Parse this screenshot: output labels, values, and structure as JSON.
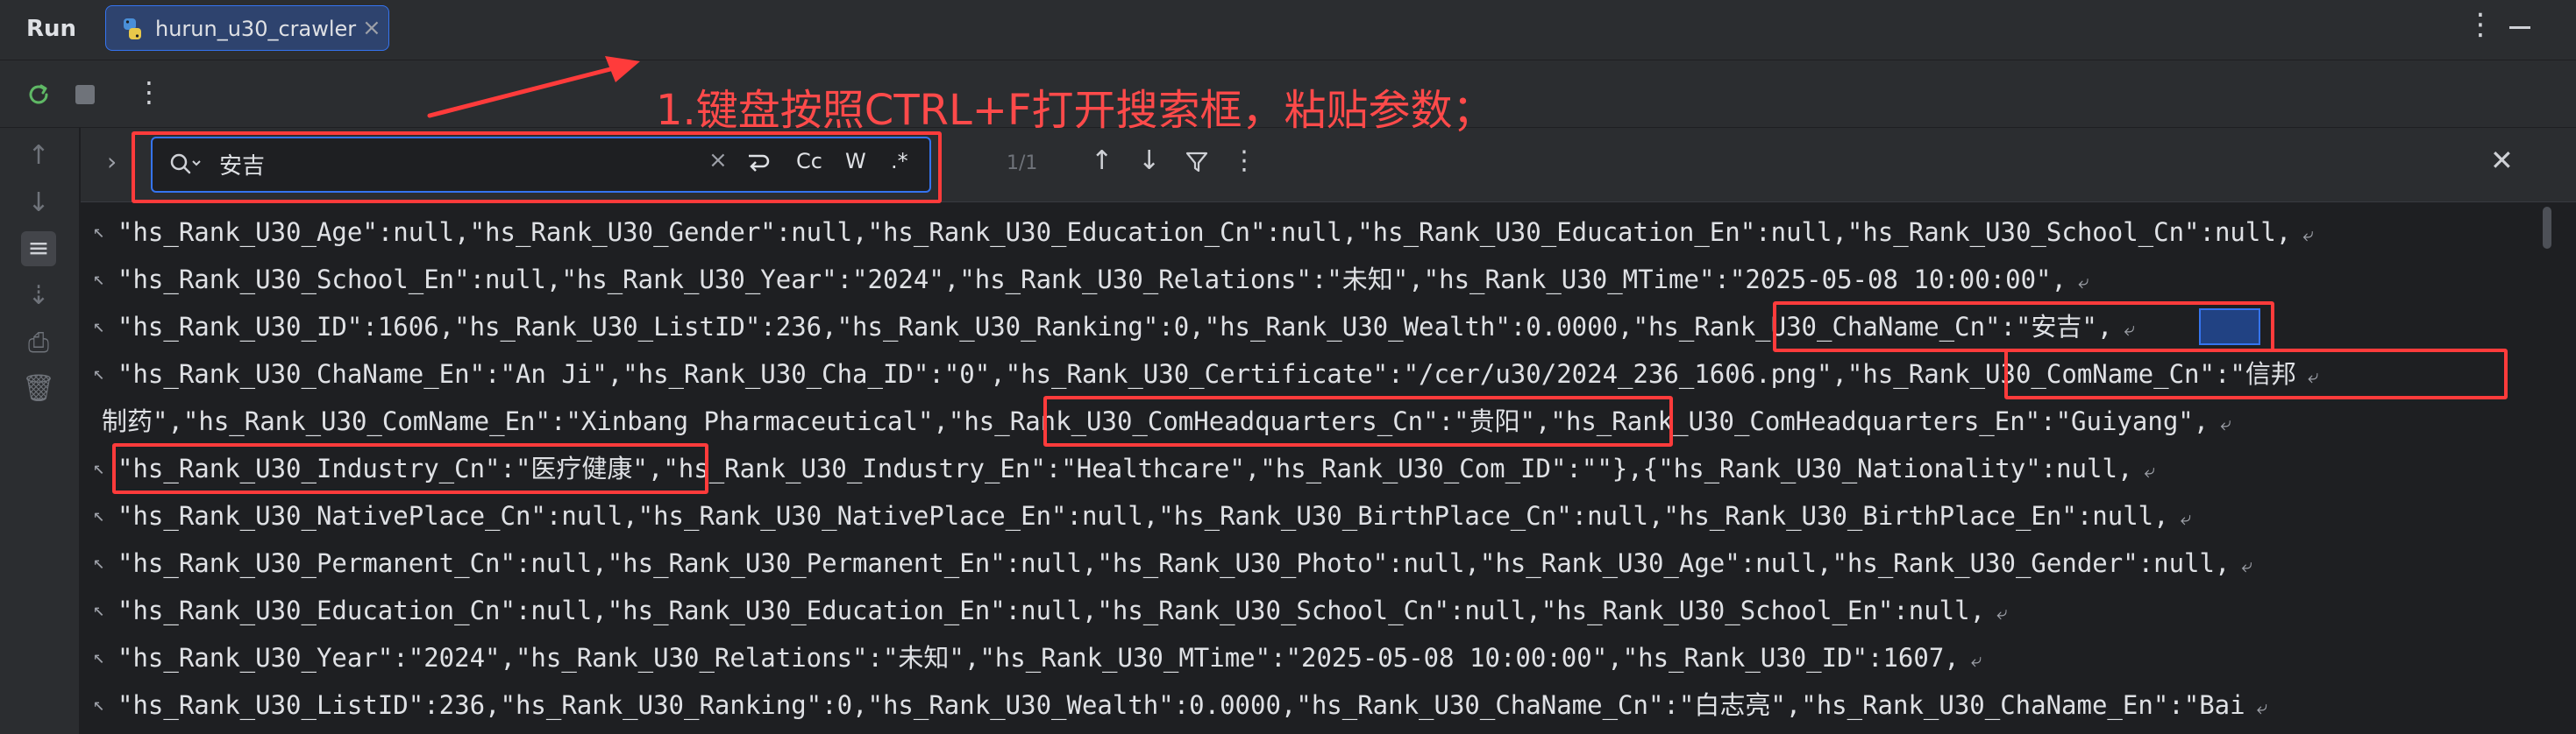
{
  "header": {
    "title": "Run",
    "tab_label": "hurun_u30_crawler"
  },
  "search": {
    "query": "安吉",
    "options": {
      "match_case": "Cc",
      "words": "W",
      "regex": ".*"
    },
    "match_count": "1/1"
  },
  "annotation": {
    "text": "1.键盘按照CTRL+F打开搜索框，粘贴参数；"
  },
  "console_lines": [
    "\"hs_Rank_U30_Age\":null,\"hs_Rank_U30_Gender\":null,\"hs_Rank_U30_Education_Cn\":null,\"hs_Rank_U30_Education_En\":null,\"hs_Rank_U30_School_Cn\":null,",
    "\"hs_Rank_U30_School_En\":null,\"hs_Rank_U30_Year\":\"2024\",\"hs_Rank_U30_Relations\":\"未知\",\"hs_Rank_U30_MTime\":\"2025-05-08 10:00:00\",",
    "\"hs_Rank_U30_ID\":1606,\"hs_Rank_U30_ListID\":236,\"hs_Rank_U30_Ranking\":0,\"hs_Rank_U30_Wealth\":0.0000,\"hs_Rank_U30_ChaName_Cn\":\"安吉\",",
    "\"hs_Rank_U30_ChaName_En\":\"An Ji\",\"hs_Rank_U30_Cha_ID\":\"0\",\"hs_Rank_U30_Certificate\":\"/cer/u30/2024_236_1606.png\",\"hs_Rank_U30_ComName_Cn\":\"信邦",
    "制药\",\"hs_Rank_U30_ComName_En\":\"Xinbang Pharmaceutical\",\"hs_Rank_U30_ComHeadquarters_Cn\":\"贵阳\",\"hs_Rank_U30_ComHeadquarters_En\":\"Guiyang\",",
    "\"hs_Rank_U30_Industry_Cn\":\"医疗健康\",\"hs_Rank_U30_Industry_En\":\"Healthcare\",\"hs_Rank_U30_Com_ID\":\"\"},{\"hs_Rank_U30_Nationality\":null,",
    "\"hs_Rank_U30_NativePlace_Cn\":null,\"hs_Rank_U30_NativePlace_En\":null,\"hs_Rank_U30_BirthPlace_Cn\":null,\"hs_Rank_U30_BirthPlace_En\":null,",
    "\"hs_Rank_U30_Permanent_Cn\":null,\"hs_Rank_U30_Permanent_En\":null,\"hs_Rank_U30_Photo\":null,\"hs_Rank_U30_Age\":null,\"hs_Rank_U30_Gender\":null,",
    "\"hs_Rank_U30_Education_Cn\":null,\"hs_Rank_U30_Education_En\":null,\"hs_Rank_U30_School_Cn\":null,\"hs_Rank_U30_School_En\":null,",
    "\"hs_Rank_U30_Year\":\"2024\",\"hs_Rank_U30_Relations\":\"未知\",\"hs_Rank_U30_MTime\":\"2025-05-08 10:00:00\",\"hs_Rank_U30_ID\":1607,",
    "\"hs_Rank_U30_ListID\":236,\"hs_Rank_U30_Ranking\":0,\"hs_Rank_U30_Wealth\":0.0000,\"hs_Rank_U30_ChaName_Cn\":\"白志亮\",\"hs_Rank_U30_ChaName_En\":\"Bai"
  ],
  "colors": {
    "annotation_red": "#ff3b3b",
    "accent_blue": "#3574f0"
  }
}
